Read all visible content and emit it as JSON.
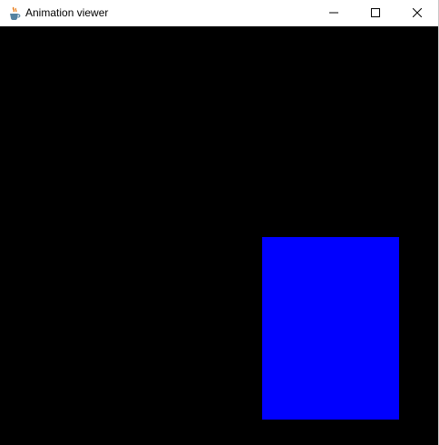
{
  "window": {
    "title": "Animation viewer",
    "app_icon": "java-cup-icon",
    "controls": {
      "minimize_icon": "minimize-icon",
      "maximize_icon": "maximize-icon",
      "close_icon": "close-icon"
    }
  },
  "canvas": {
    "background_color": "#000000",
    "shapes": [
      {
        "type": "rectangle",
        "color": "#0000ff"
      }
    ]
  }
}
